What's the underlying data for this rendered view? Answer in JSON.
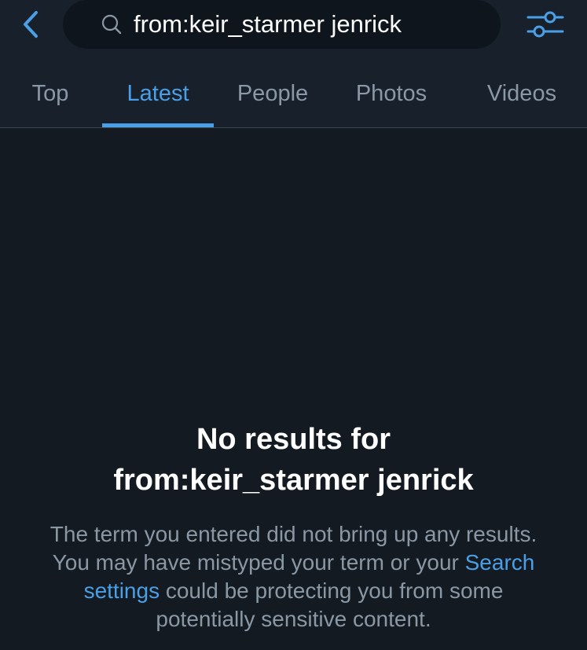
{
  "header": {
    "search_query": "from:keir_starmer jenrick",
    "back_icon": "chevron-left-icon",
    "search_icon": "search-icon",
    "filter_icon": "sliders-icon"
  },
  "tabs": [
    {
      "label": "Top",
      "active": false
    },
    {
      "label": "Latest",
      "active": true
    },
    {
      "label": "People",
      "active": false
    },
    {
      "label": "Photos",
      "active": false
    },
    {
      "label": "Videos",
      "active": false
    }
  ],
  "empty_state": {
    "title_line1": "No results for",
    "title_line2": "from:keir_starmer jenrick",
    "desc_before": "The term you entered did not bring up any results. You may have mistyped your term or your ",
    "desc_link": "Search settings",
    "desc_after": " could be protecting you from some potentially sensitive content."
  },
  "colors": {
    "accent": "#4a9fe6",
    "background": "#141a21",
    "header_background": "#18212b",
    "muted_text": "#8a98a6"
  }
}
